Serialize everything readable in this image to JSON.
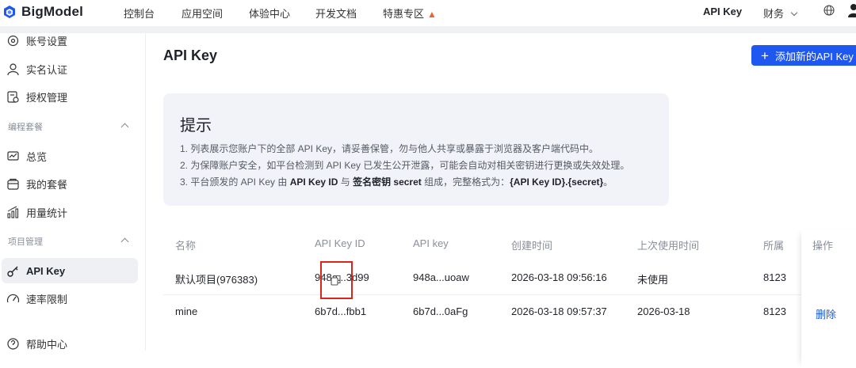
{
  "topbar": {
    "logo": "BigModel",
    "nav": [
      "控制台",
      "应用空间",
      "体验中心",
      "开发文档",
      "特惠专区"
    ],
    "api_key": "API Key",
    "finance": "财务"
  },
  "sidebar": {
    "items_top": [
      {
        "label": "账号设置",
        "icon": "gear-icon"
      },
      {
        "label": "实名认证",
        "icon": "user-icon"
      },
      {
        "label": "授权管理",
        "icon": "auth-doc-icon"
      }
    ],
    "group1": "编程套餐",
    "items_mid": [
      {
        "label": "总览",
        "icon": "dashboard-icon"
      },
      {
        "label": "我的套餐",
        "icon": "package-icon"
      },
      {
        "label": "用量统计",
        "icon": "bar-chart-icon"
      }
    ],
    "group2": "项目管理",
    "items_bottom": [
      {
        "label": "API Key",
        "icon": "key-icon",
        "active": true
      },
      {
        "label": "速率限制",
        "icon": "speed-icon"
      },
      {
        "label": "帮助中心",
        "icon": "help-icon"
      }
    ]
  },
  "main": {
    "title": "API Key",
    "add_button": "添加新的API Key",
    "tip": {
      "title": "提示",
      "line1": "1. 列表展示您账户下的全部 API Key，请妥善保管，勿与他人共享或暴露于浏览器及客户端代码中。",
      "line2": "2. 为保障账户安全，如平台检测到 API Key 已发生公开泄露，可能会自动对相关密钥进行更换或失效处理。",
      "line3_a": "3. 平台颁发的 API Key 由 ",
      "line3_b": "API Key ID",
      "line3_c": " 与 ",
      "line3_d": "签名密钥 secret",
      "line3_e": " 组成，完整格式为：",
      "line3_f": "{API Key ID}.{secret}",
      "line3_g": "。"
    },
    "table": {
      "headers": [
        "名称",
        "API Key ID",
        "API key",
        "创建时间",
        "上次使用时间",
        "所属",
        "操作"
      ],
      "rows": [
        {
          "name": "默认项目(976383)",
          "key_id": "948a...3d99",
          "key": "948a...uoaw",
          "created": "2026-03-18 09:56:16",
          "last_used": "未使用",
          "owner": "8123",
          "action": ""
        },
        {
          "name": "mine",
          "key_id": "6b7d...fbb1",
          "key": "6b7d...0aFg",
          "created": "2026-03-18 09:57:37",
          "last_used": "2026-03-18",
          "owner": "8123",
          "action": "删除"
        }
      ]
    }
  },
  "colors": {
    "accent": "#1e58f0",
    "highlight_box": "#d9251c"
  }
}
